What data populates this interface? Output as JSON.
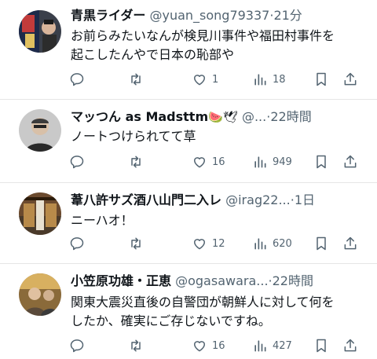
{
  "tweets": [
    {
      "name": "青黒ライダー",
      "handle": "@yuan_song79337",
      "time": "21分",
      "emoji": "",
      "text_lines": [
        "お前らみたいなんが検見川事件や福田村事件を",
        "起こしたんやで日本の恥部や"
      ],
      "replies": "",
      "retweets": "",
      "likes": "1",
      "views": "18"
    },
    {
      "name": "マッつん as Madsttm",
      "handle": "@...",
      "time": "22時間",
      "emoji": "🍉🕊",
      "text_lines": [
        "ノートつけられてて草"
      ],
      "replies": "",
      "retweets": "",
      "likes": "16",
      "views": "949"
    },
    {
      "name": "葦八許サズ酒八山門二入レ",
      "handle": "@irag22...",
      "time": "1日",
      "emoji": "",
      "text_lines": [
        "ニーハオ！"
      ],
      "replies": "",
      "retweets": "",
      "likes": "12",
      "views": "620"
    },
    {
      "name": "小笠原功雄・正恵",
      "handle": "@ogasawara...",
      "time": "22時間",
      "emoji": "",
      "text_lines": [
        "関東大震災直後の自警団が朝鮮人に対して何を",
        "したか、確実にご存じないですね。"
      ],
      "replies": "",
      "retweets": "",
      "likes": "16",
      "views": "427"
    }
  ],
  "separator": "·",
  "icons": [
    "reply-icon",
    "retweet-icon",
    "like-icon",
    "views-icon",
    "bookmark-icon",
    "share-icon"
  ],
  "colors": {
    "text": "#0f1419",
    "muted": "#536471",
    "border": "#e6e6e6"
  }
}
